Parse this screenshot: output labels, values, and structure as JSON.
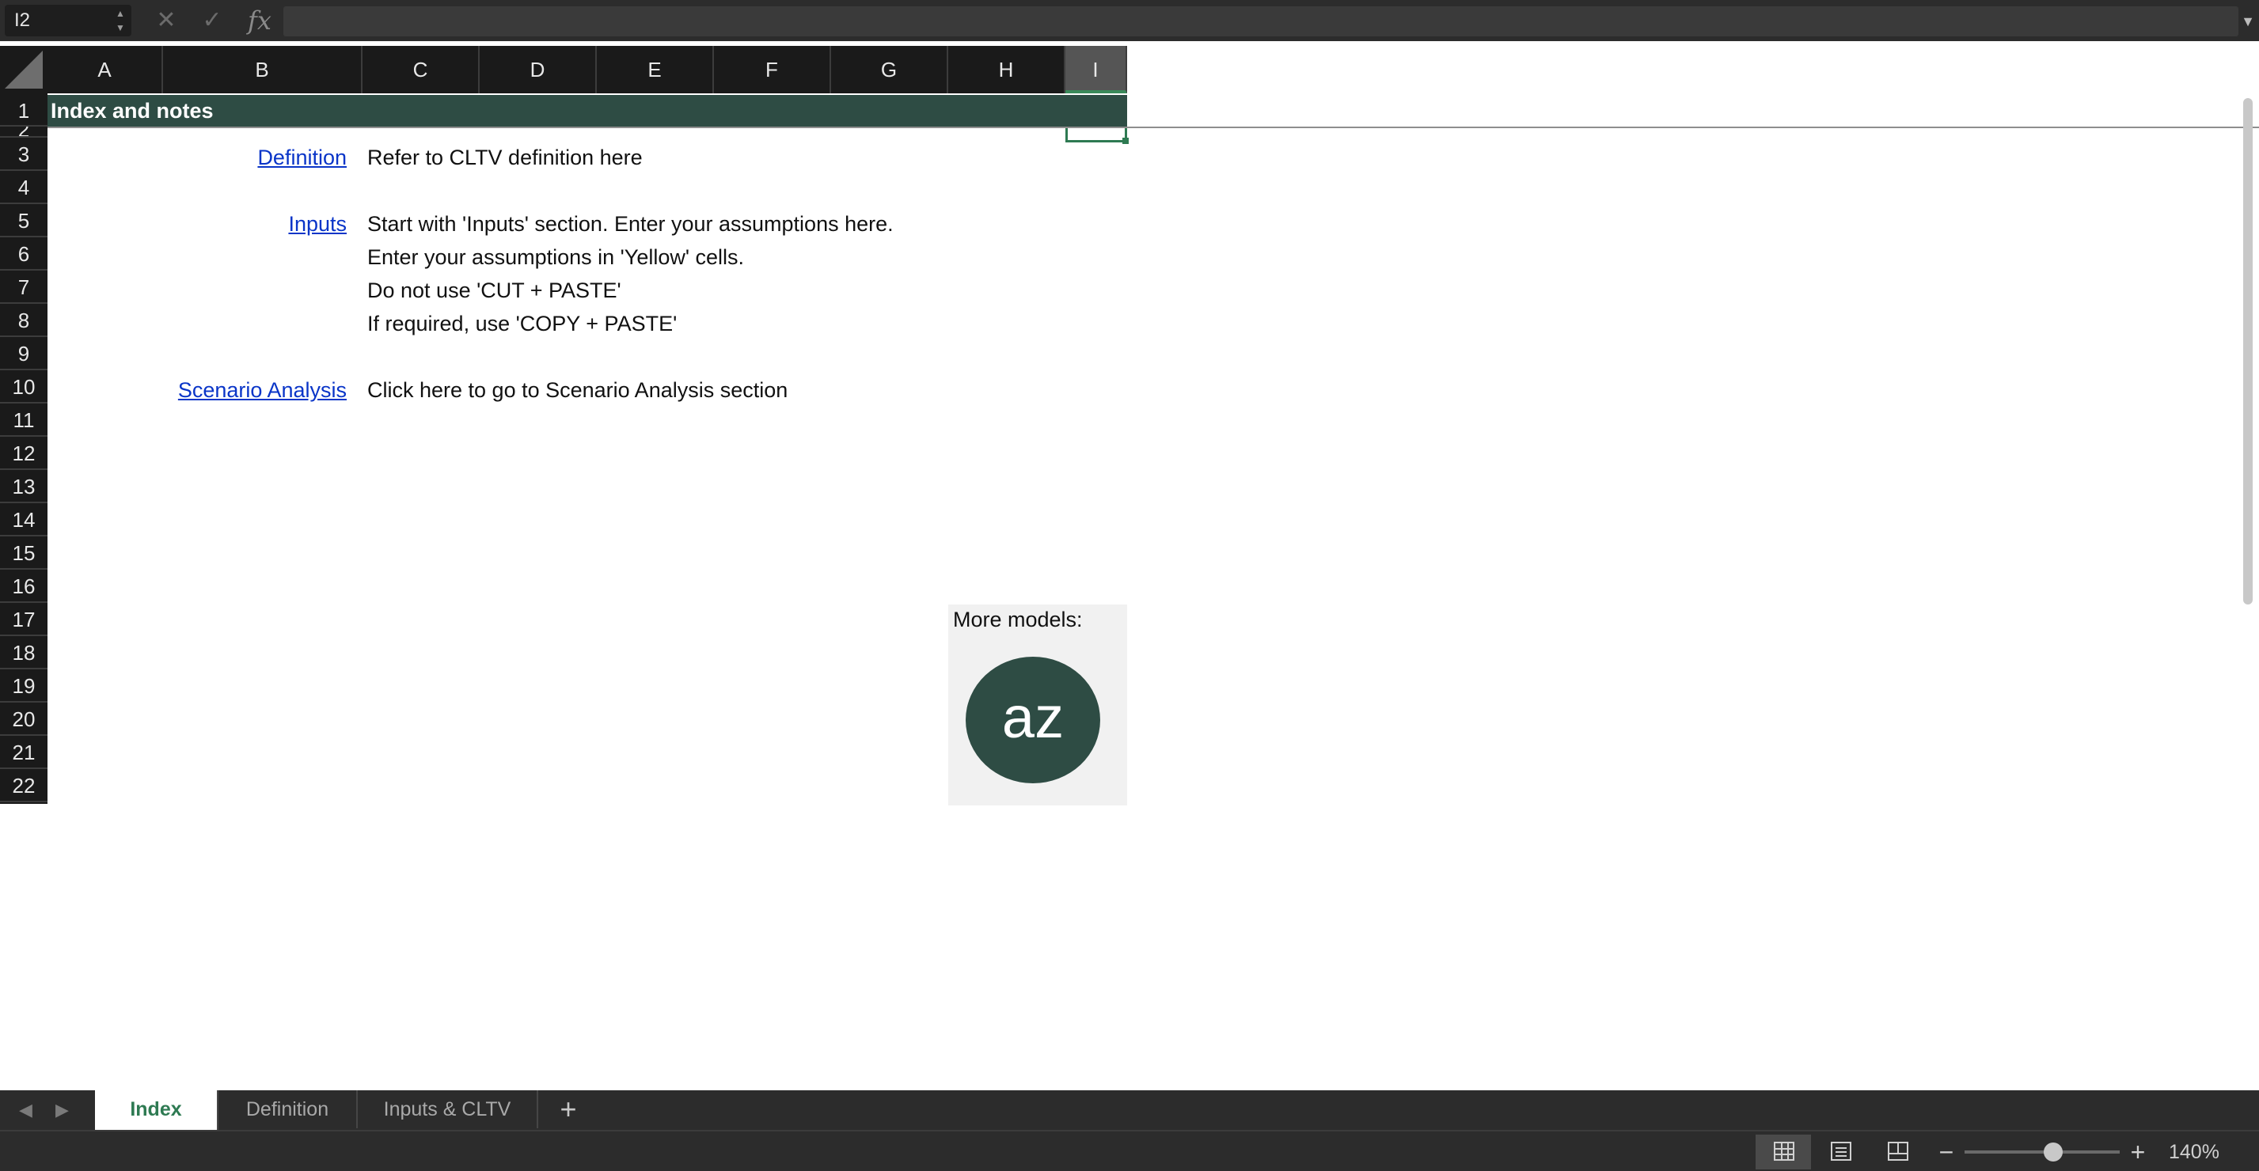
{
  "formula_bar": {
    "name_box": "I2",
    "cancel_icon": "x-icon",
    "confirm_icon": "check-icon",
    "function_icon": "fx-icon",
    "fx_label": "fx",
    "formula": ""
  },
  "columns": [
    "A",
    "B",
    "C",
    "D",
    "E",
    "F",
    "G",
    "H",
    "I"
  ],
  "selected_column": "I",
  "rows": [
    "1",
    "2",
    "3",
    "4",
    "5",
    "6",
    "7",
    "8",
    "9",
    "10",
    "11",
    "12",
    "13",
    "14",
    "15",
    "16",
    "17",
    "18",
    "19",
    "20",
    "21",
    "22"
  ],
  "sheet": {
    "title": "Index and notes",
    "links": {
      "definition": "Definition",
      "inputs": "Inputs",
      "scenario_analysis": "Scenario Analysis"
    },
    "notes": {
      "row3": "Refer to CLTV definition here",
      "row5": "Start with 'Inputs' section. Enter your assumptions here.",
      "row6": "Enter your assumptions in 'Yellow' cells.",
      "row7": "Do not use 'CUT + PASTE'",
      "row8": "If required, use 'COPY + PASTE'",
      "row10": "Click here to go to Scenario Analysis section"
    },
    "more_models": {
      "label": "More models:",
      "logo_text": "az"
    }
  },
  "tabs": {
    "items": [
      "Index",
      "Definition",
      "Inputs & CLTV"
    ],
    "active": "Index",
    "add_label": "+"
  },
  "status_bar": {
    "zoom_out_label": "−",
    "zoom_in_label": "+",
    "zoom": "140%",
    "zoom_slider_fraction": 0.51
  },
  "colors": {
    "header_band": "#2e4c44",
    "link": "#0a35c8",
    "selection": "#2e7a52"
  }
}
